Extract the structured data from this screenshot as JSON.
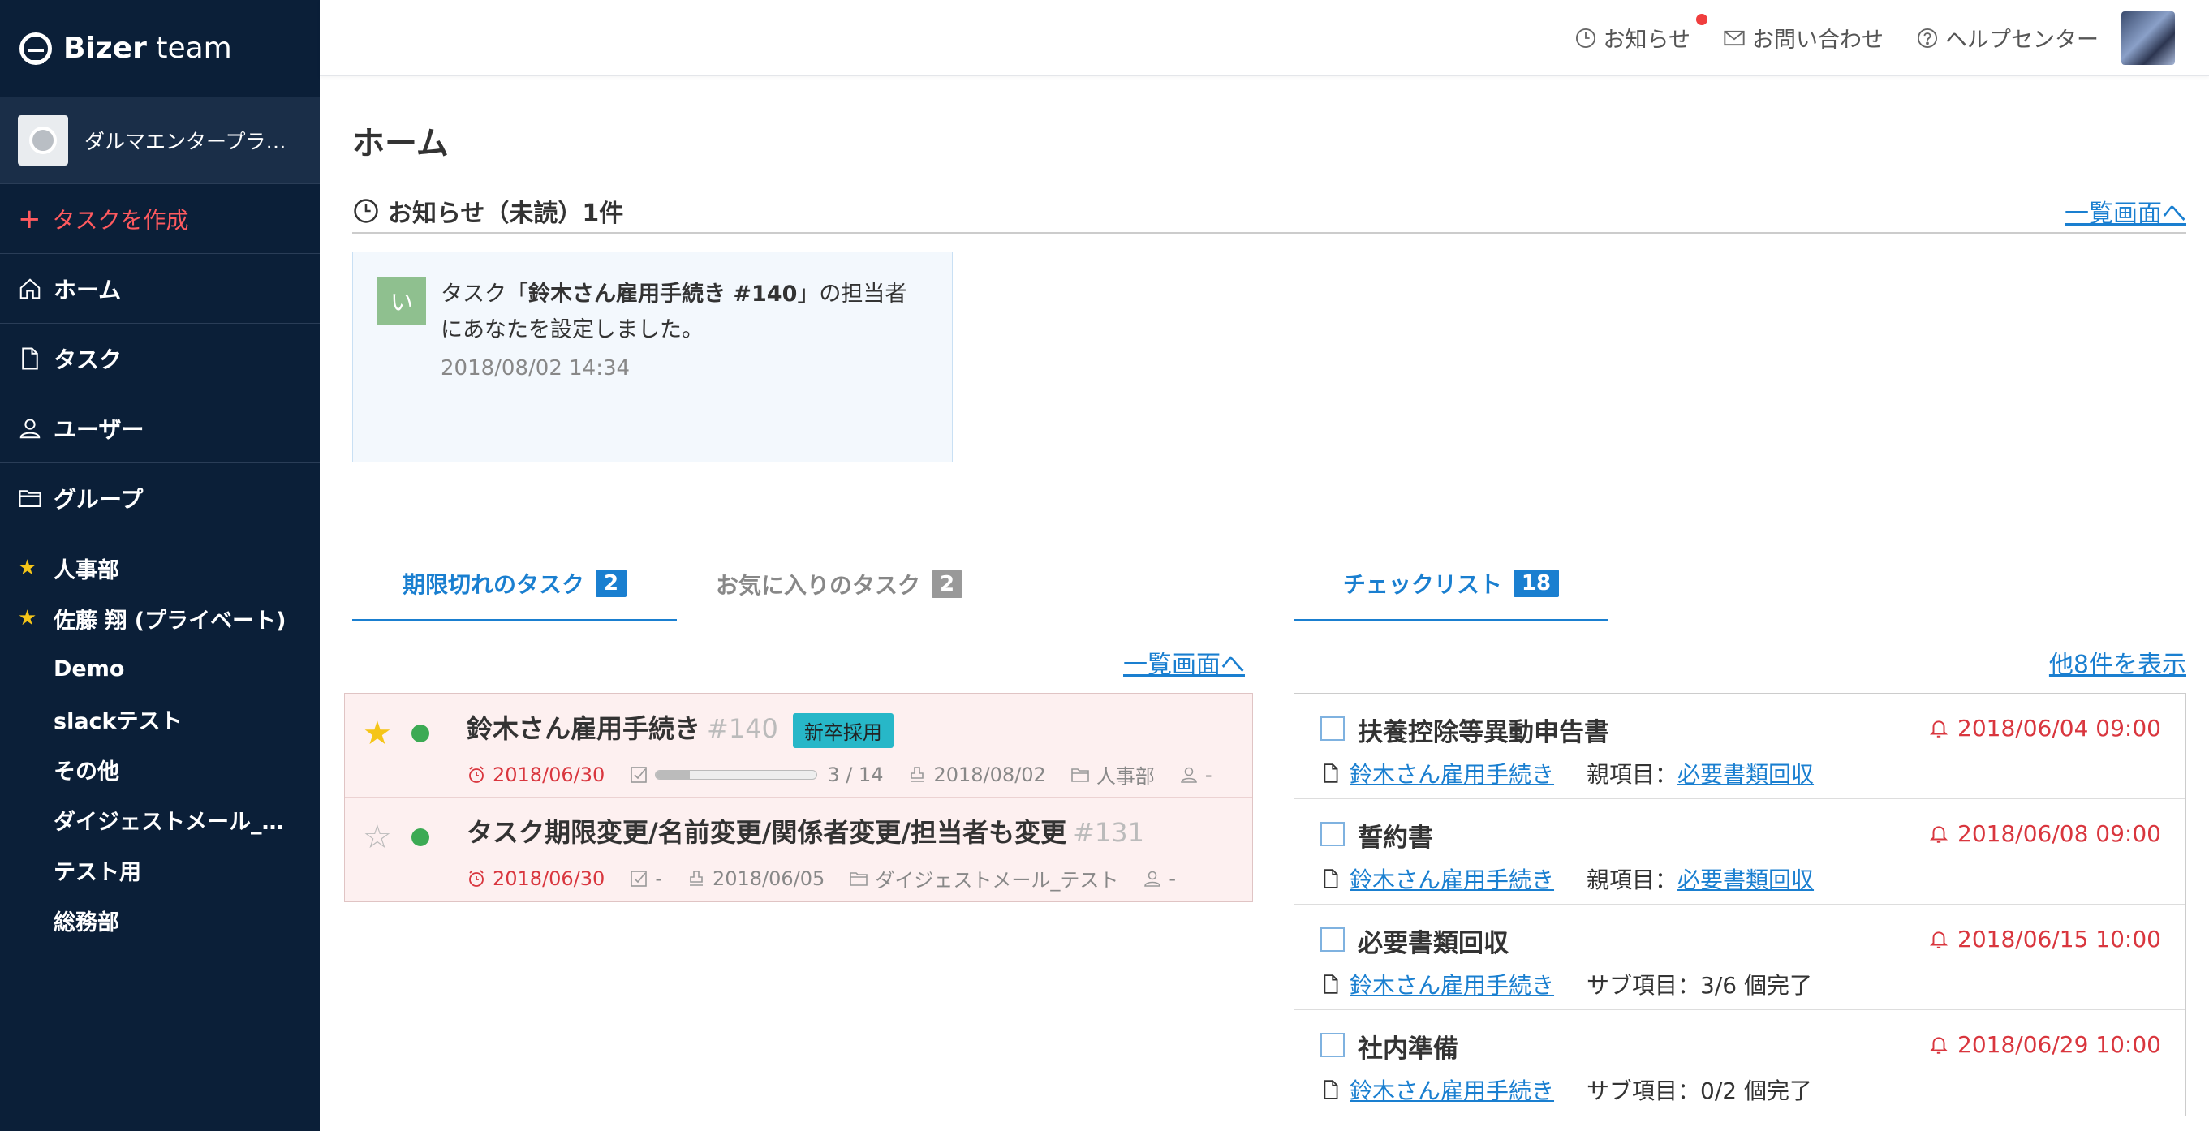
{
  "sidebar": {
    "logo_bold": "Bizer",
    "logo_rest": " team",
    "org_name": "ダルマエンタープラ…",
    "create_label": "タスクを作成",
    "nav": [
      {
        "label": "ホーム",
        "icon": "home-icon"
      },
      {
        "label": "タスク",
        "icon": "document-icon"
      },
      {
        "label": "ユーザー",
        "icon": "user-icon"
      },
      {
        "label": "グループ",
        "icon": "folder-icon"
      }
    ],
    "groups": [
      {
        "label": "人事部",
        "starred": true
      },
      {
        "label": "佐藤 翔 (プライベート)",
        "starred": true
      },
      {
        "label": "Demo",
        "starred": false
      },
      {
        "label": "slackテスト",
        "starred": false
      },
      {
        "label": "その他",
        "starred": false
      },
      {
        "label": "ダイジェストメール_…",
        "starred": false
      },
      {
        "label": "テスト用",
        "starred": false
      },
      {
        "label": "総務部",
        "starred": false
      }
    ]
  },
  "header": {
    "notice": "お知らせ",
    "contact": "お問い合わせ",
    "help": "ヘルプセンター"
  },
  "main": {
    "title": "ホーム",
    "notice_section_title": "お知らせ（未読）1件",
    "list_link": "一覧画面へ",
    "notice": {
      "avatar_char": "い",
      "text_pre": "タスク「",
      "text_bold": "鈴木さん雇用手続き #140",
      "text_post": "」の担当者にあなたを設定しました。",
      "time": "2018/08/02 14:34"
    }
  },
  "tasks_panel": {
    "tab_overdue": "期限切れのタスク",
    "tab_overdue_count": "2",
    "tab_fav": "お気に入りのタスク",
    "tab_fav_count": "2",
    "link": "一覧画面へ",
    "items": [
      {
        "starred": true,
        "title": "鈴木さん雇用手続き",
        "number": "#140",
        "tag": "新卒採用",
        "due": "2018/06/30",
        "progress_text": "3 / 14",
        "progress": 0.214,
        "start": "2018/08/02",
        "group": "人事部",
        "assignee": "-"
      },
      {
        "starred": false,
        "title": "タスク期限変更/名前変更/関係者変更/担当者も変更",
        "number": "#131",
        "tag": "",
        "due": "2018/06/30",
        "progress_text": "-",
        "start": "2018/06/05",
        "group": "ダイジェストメール_テスト",
        "assignee": "-"
      }
    ]
  },
  "checklist_panel": {
    "tab_label": "チェックリスト",
    "tab_count": "18",
    "more_link": "他8件を表示",
    "items": [
      {
        "title": "扶養控除等異動申告書",
        "due": "2018/06/04 09:00",
        "task": "鈴木さん雇用手続き",
        "sub_label": "親項目：",
        "sub_link": "必要書類回収",
        "sub_text": ""
      },
      {
        "title": "誓約書",
        "due": "2018/06/08 09:00",
        "task": "鈴木さん雇用手続き",
        "sub_label": "親項目：",
        "sub_link": "必要書類回収",
        "sub_text": ""
      },
      {
        "title": "必要書類回収",
        "due": "2018/06/15 10:00",
        "task": "鈴木さん雇用手続き",
        "sub_label": "サブ項目：3/6 個完了",
        "sub_link": "",
        "sub_text": ""
      },
      {
        "title": "社内準備",
        "due": "2018/06/29 10:00",
        "task": "鈴木さん雇用手続き",
        "sub_label": "サブ項目：0/2 個完了",
        "sub_link": "",
        "sub_text": ""
      }
    ]
  }
}
